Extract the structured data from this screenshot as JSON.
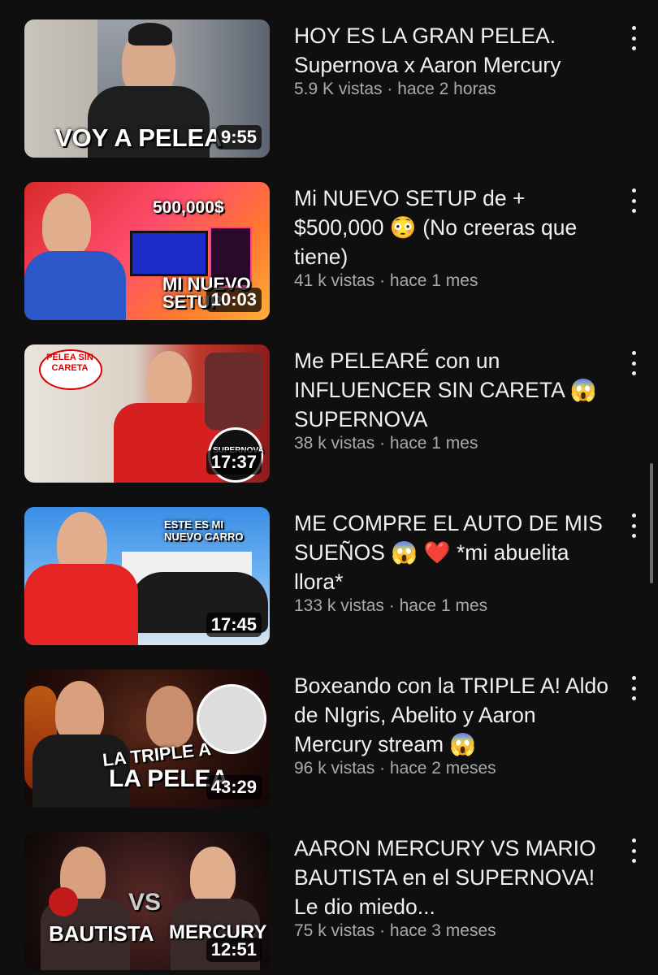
{
  "videos": [
    {
      "title": "HOY ES LA GRAN PELEA. Supernova x Aaron Mercury",
      "views": "5.9 K vistas",
      "age": "hace 2 horas",
      "duration": "9:55",
      "thumb_text": "VOY A PELEA"
    },
    {
      "title": "Mi NUEVO SETUP de + $500,000 😳  (No creeras que tiene)",
      "views": "41 k vistas",
      "age": "hace 1 mes",
      "duration": "10:03",
      "thumb_text": "500,000$",
      "thumb_text2": "MI NUEVO SETUP"
    },
    {
      "title": "Me PELEARÉ con un INFLUENCER SIN CARETA 😱 SUPERNOVA",
      "views": "38 k vistas",
      "age": "hace 1 mes",
      "duration": "17:37",
      "thumb_text": "PELEA SIN CARETA",
      "thumb_text2": "SUPERNOVA"
    },
    {
      "title": "ME COMPRE EL AUTO DE MIS SUEÑOS 😱 ❤️  *mi abuelita llora*",
      "views": "133 k vistas",
      "age": "hace 1 mes",
      "duration": "17:45",
      "thumb_text": "ESTE ES MI NUEVO CARRO"
    },
    {
      "title": "Boxeando con la TRIPLE A! Aldo de NIgris, Abelito y Aaron Mercury stream 😱",
      "views": "96 k vistas",
      "age": "hace 2 meses",
      "duration": "43:29",
      "thumb_text": "LA TRIPLE A",
      "thumb_text2": "LA PELEA"
    },
    {
      "title": "AARON MERCURY VS MARIO BAUTISTA en el SUPERNOVA! Le dio miedo...",
      "views": "75 k vistas",
      "age": "hace 3 meses",
      "duration": "12:51",
      "thumb_text": "BAUTISTA",
      "thumb_text2": "VS",
      "thumb_text3": "MERCURY"
    }
  ],
  "separator": "·",
  "icons": {
    "menu": "more-vert-icon"
  }
}
